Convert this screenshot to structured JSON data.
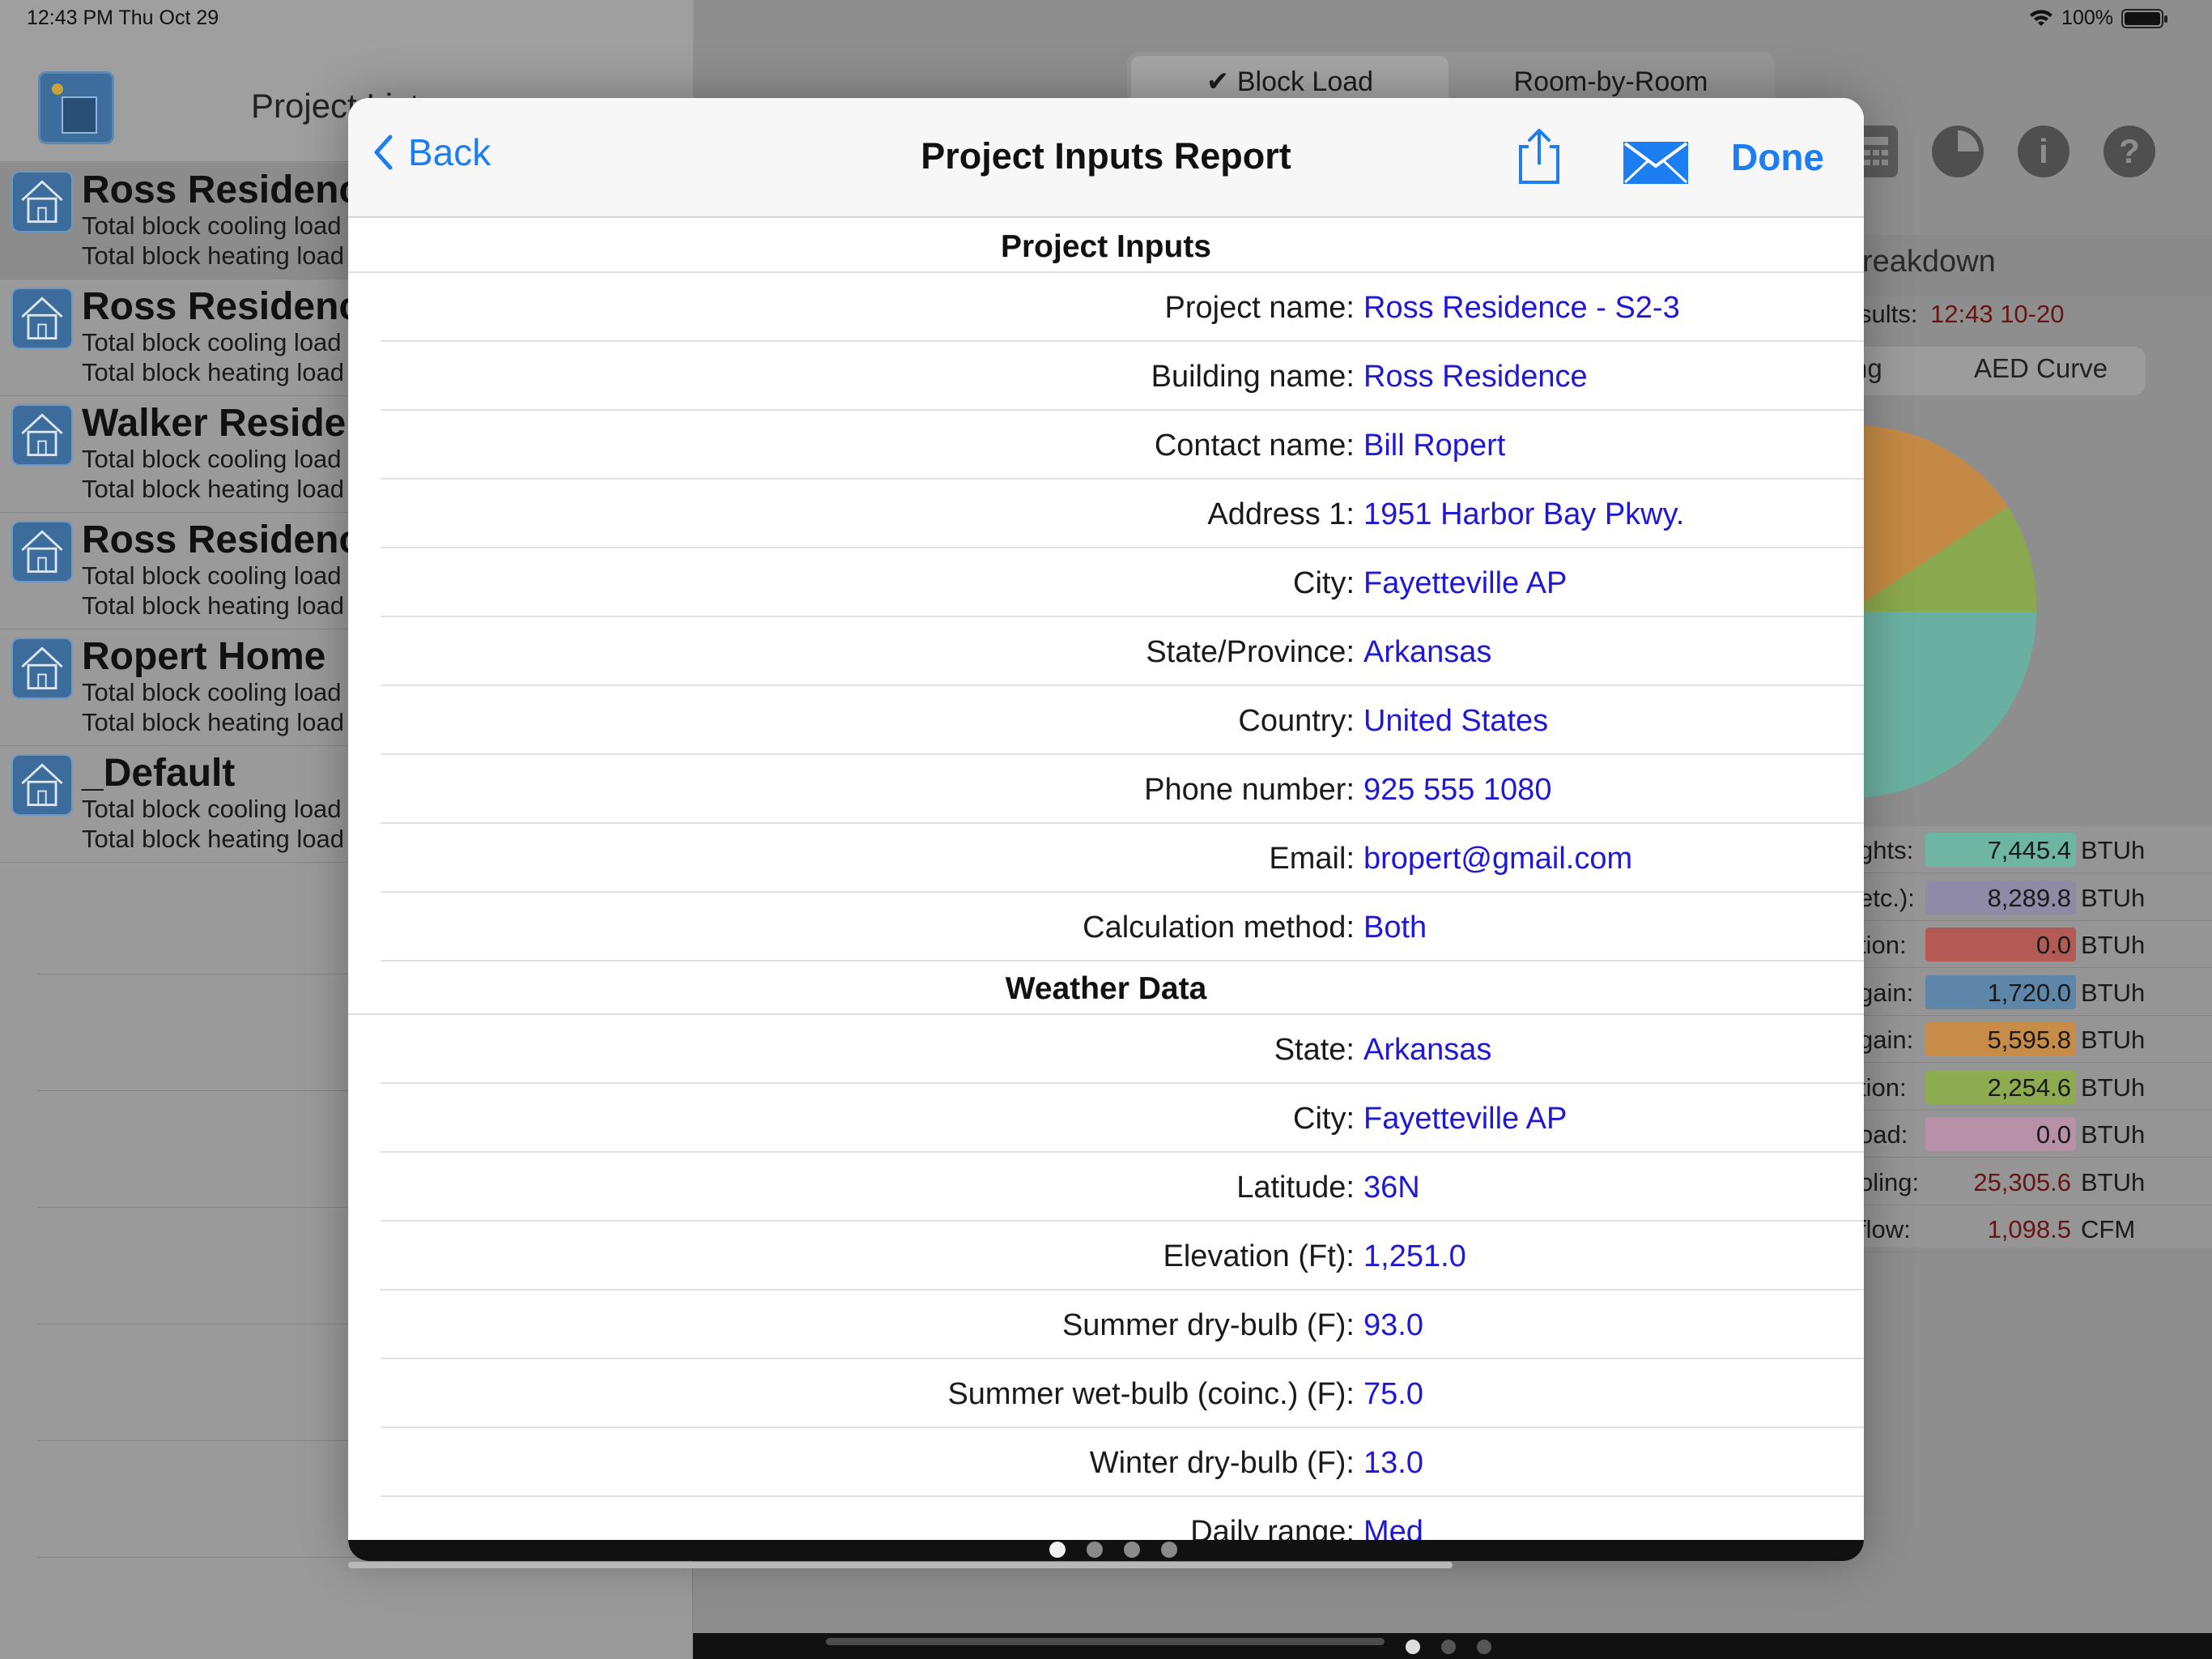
{
  "status_bar": {
    "time": "12:43 PM   Thu Oct 29",
    "battery": "100%"
  },
  "left_pane": {
    "title": "Project List",
    "projects": [
      {
        "name": "Ross Residence",
        "line1": "Total block cooling load",
        "line2": "Total block heating load",
        "selected": true
      },
      {
        "name": "Ross Residence",
        "line1": "Total block cooling load",
        "line2": "Total block heating load",
        "selected": false
      },
      {
        "name": "Walker Residence",
        "line1": "Total block cooling load",
        "line2": "Total block heating load",
        "selected": false
      },
      {
        "name": "Ross Residence",
        "line1": "Total block cooling load",
        "line2": "Total block heating load",
        "selected": false
      },
      {
        "name": "Ropert Home",
        "line1": "Total block cooling load",
        "line2": "Total block heating load",
        "selected": false
      },
      {
        "name": "_Default",
        "line1": "Total block cooling load",
        "line2": "Total block heating load",
        "selected": false
      }
    ]
  },
  "right_pane": {
    "tabs": [
      {
        "label": "✔ Block Load",
        "active": true
      },
      {
        "label": "Room-by-Room",
        "active": false
      }
    ],
    "toolbar_icons": [
      "calculator-icon",
      "pie-chart-icon",
      "info-icon",
      "help-icon"
    ],
    "breakdown_title": "reakdown",
    "results_label": "sults:",
    "results_value": "12:43 10-20",
    "segments": [
      "ng",
      "AED Curve"
    ],
    "legend": [
      {
        "label": "ghts:",
        "value": "7,445.4",
        "unit": "BTUh",
        "color": "#6fb5a4"
      },
      {
        "label": "etc.):",
        "value": "8,289.8",
        "unit": "BTUh",
        "color": "#8f8aa6"
      },
      {
        "label": "tion:",
        "value": "0.0",
        "unit": "BTUh",
        "color": "#b35a55"
      },
      {
        "label": "gain:",
        "value": "1,720.0",
        "unit": "BTUh",
        "color": "#5e86a8"
      },
      {
        "label": "gain:",
        "value": "5,595.8",
        "unit": "BTUh",
        "color": "#c78c48"
      },
      {
        "label": "tion:",
        "value": "2,254.6",
        "unit": "BTUh",
        "color": "#8dab4f"
      },
      {
        "label": "oad:",
        "value": "0.0",
        "unit": "BTUh",
        "color": "#b890a8"
      },
      {
        "label": "oling:",
        "value": "25,305.6",
        "unit": "BTUh",
        "color": ""
      },
      {
        "label": "flow:",
        "value": "1,098.5",
        "unit": "CFM",
        "color": ""
      }
    ]
  },
  "modal": {
    "back_label": "Back",
    "title": "Project Inputs Report",
    "done_label": "Done",
    "sections": [
      {
        "header": "Project Inputs",
        "rows": [
          {
            "label": "Project name:",
            "value": "Ross Residence - S2-3"
          },
          {
            "label": "Building name:",
            "value": "Ross Residence"
          },
          {
            "label": "Contact name:",
            "value": "Bill Ropert"
          },
          {
            "label": "Address 1:",
            "value": "1951 Harbor Bay Pkwy."
          },
          {
            "label": "City:",
            "value": "Fayetteville AP"
          },
          {
            "label": "State/Province:",
            "value": "Arkansas"
          },
          {
            "label": "Country:",
            "value": "United States"
          },
          {
            "label": "Phone number:",
            "value": "925 555 1080"
          },
          {
            "label": "Email:",
            "value": "bropert@gmail.com"
          },
          {
            "label": "Calculation method:",
            "value": "Both"
          }
        ]
      },
      {
        "header": "Weather Data",
        "rows": [
          {
            "label": "State:",
            "value": "Arkansas"
          },
          {
            "label": "City:",
            "value": "Fayetteville AP"
          },
          {
            "label": "Latitude:",
            "value": "36N"
          },
          {
            "label": "Elevation (Ft):",
            "value": "1,251.0"
          },
          {
            "label": "Summer dry-bulb (F):",
            "value": "93.0"
          },
          {
            "label": "Summer wet-bulb (coinc.) (F):",
            "value": "75.0"
          },
          {
            "label": "Winter dry-bulb (F):",
            "value": "13.0"
          },
          {
            "label": "Daily range:",
            "value": "Med"
          }
        ]
      }
    ],
    "page_count": 4,
    "current_page": 1
  },
  "colors": {
    "accent": "#1c7ef0",
    "value_text": "#1f19d4",
    "results_red": "#6a1313"
  }
}
